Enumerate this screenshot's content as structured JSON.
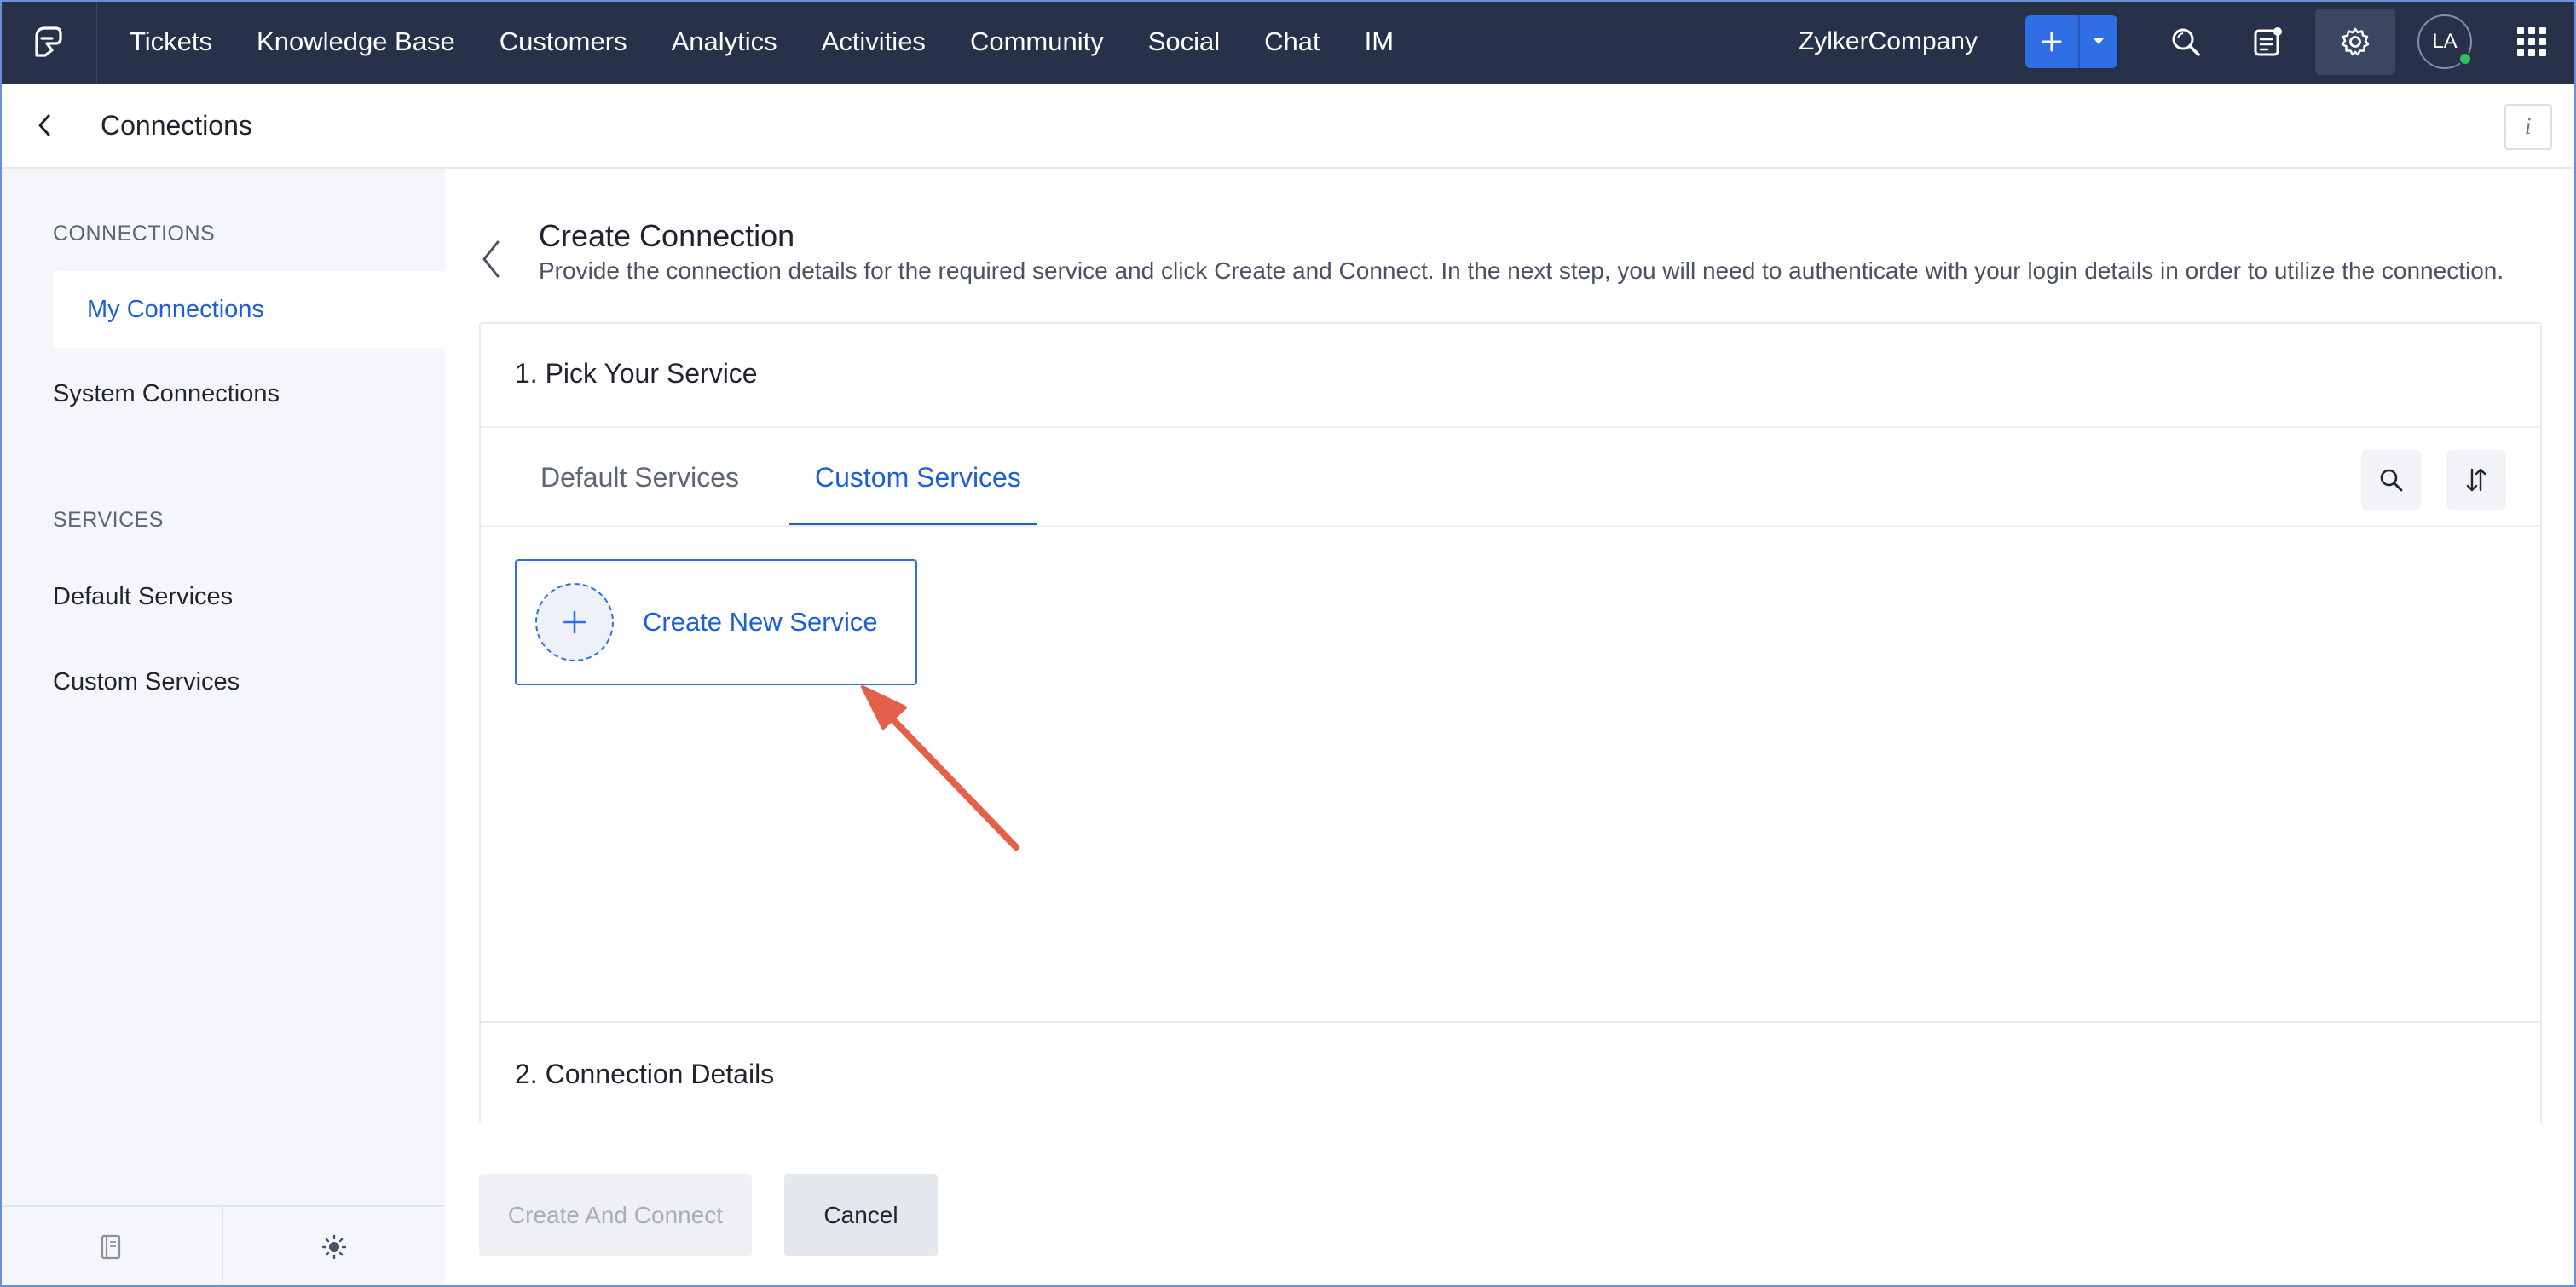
{
  "topnav": {
    "logo_icon": "zoho-desk-logo-icon",
    "items": [
      "Tickets",
      "Knowledge Base",
      "Customers",
      "Analytics",
      "Activities",
      "Community",
      "Social",
      "Chat",
      "IM"
    ],
    "company": "ZylkerCompany",
    "avatar_initials": "LA",
    "icons": [
      "plus-icon",
      "caret-down-icon",
      "search-icon",
      "notifications-icon",
      "gear-icon",
      "apps-grid-icon"
    ],
    "colors": {
      "bar": "#273149",
      "accent": "#2f6fe3",
      "online": "#2fbf5b"
    }
  },
  "subheader": {
    "title": "Connections",
    "info_label": "i"
  },
  "sidebar": {
    "sections": [
      {
        "label": "CONNECTIONS",
        "items": [
          {
            "label": "My Connections",
            "active": true
          },
          {
            "label": "System Connections",
            "active": false
          }
        ]
      },
      {
        "label": "SERVICES",
        "items": [
          {
            "label": "Default Services",
            "active": false
          },
          {
            "label": "Custom Services",
            "active": false
          }
        ]
      }
    ],
    "bottom_icons": [
      "book-icon",
      "sun-icon"
    ]
  },
  "main": {
    "title": "Create Connection",
    "description": "Provide the connection details for the required service and click Create and Connect. In the next step, you will need to authenticate with your login details in order to utilize the connection.",
    "step1": {
      "title": "1. Pick Your Service",
      "tabs": [
        {
          "label": "Default Services",
          "active": false
        },
        {
          "label": "Custom Services",
          "active": true
        }
      ],
      "create_service_label": "Create New Service"
    },
    "step2": {
      "title": "2. Connection Details"
    },
    "actions": {
      "primary": "Create And Connect",
      "cancel": "Cancel"
    }
  }
}
